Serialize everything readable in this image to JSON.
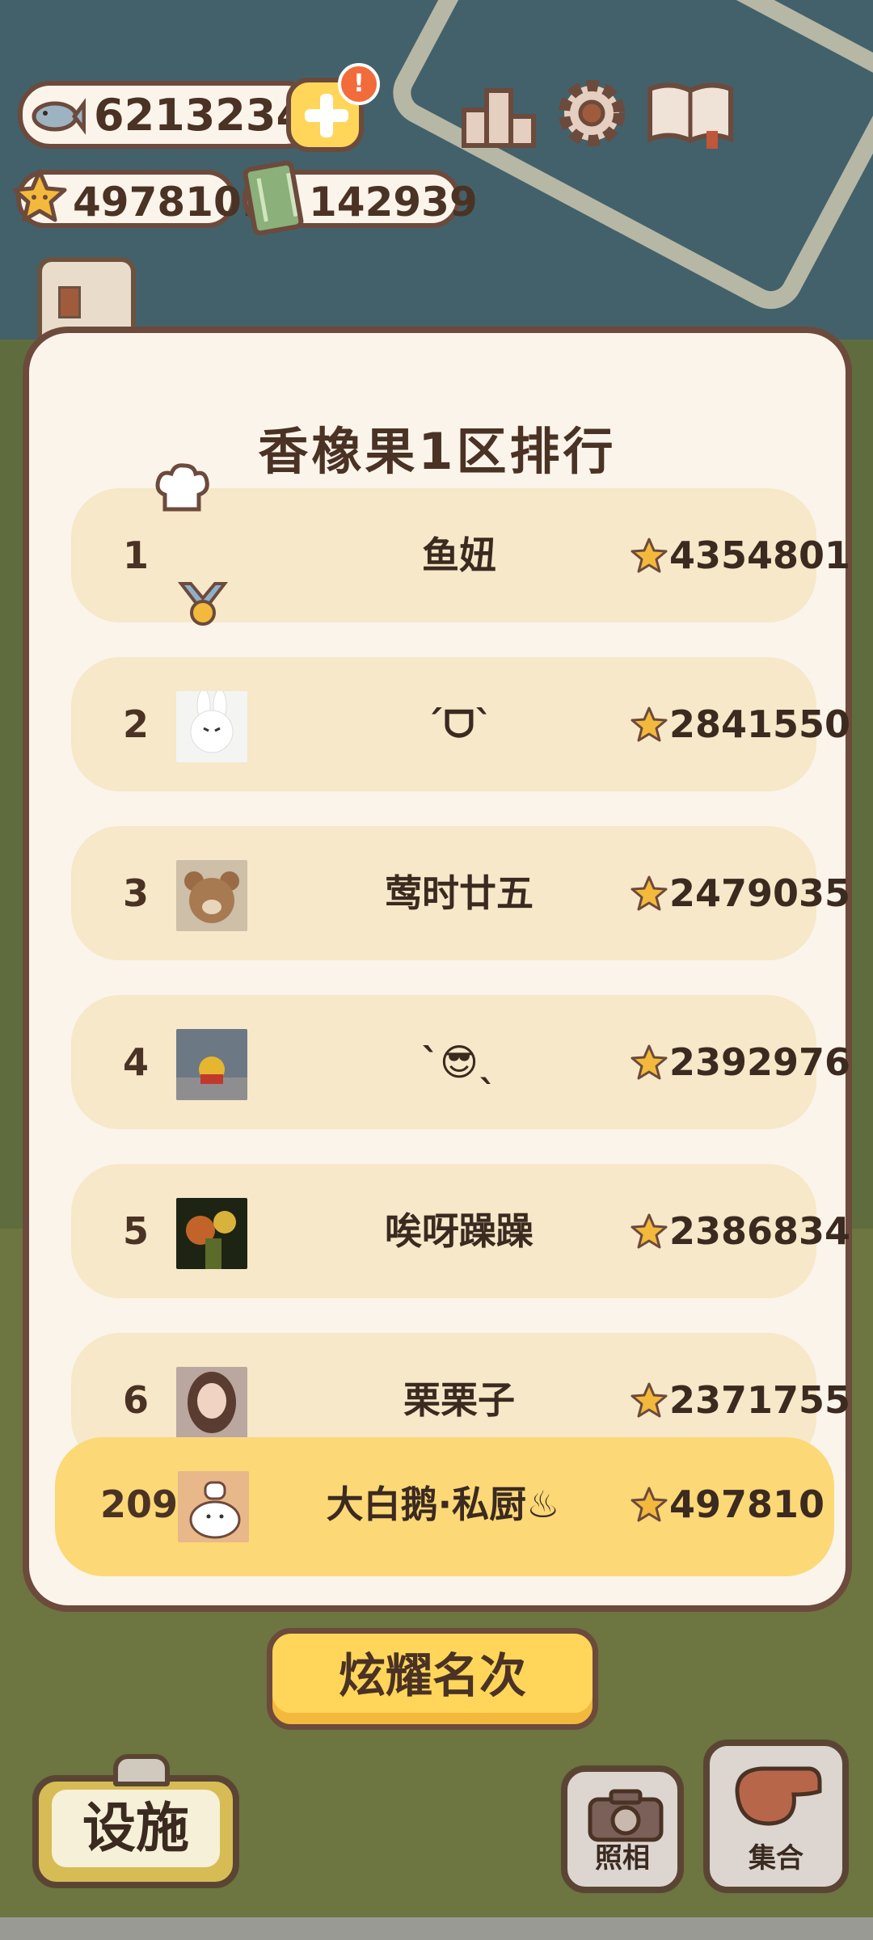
{
  "currencies": {
    "fish": "62132340",
    "stars": "497810.",
    "tickets": "142939",
    "alert_badge": "!"
  },
  "icons": {
    "fish": "fish-icon",
    "add": "plus-icon",
    "star": "star-icon",
    "ticket": "ticket-icon",
    "ranking": "podium-icon",
    "settings": "gear-icon",
    "guide": "book-icon"
  },
  "leaderboard": {
    "title": "香橡果1区排行",
    "rows": [
      {
        "rank": "1",
        "name": "鱼妞",
        "score": "4354801",
        "avatar": "none"
      },
      {
        "rank": "2",
        "name": "ˊᗜˋ",
        "score": "2841550",
        "avatar": "rabbit"
      },
      {
        "rank": "3",
        "name": "莺时廿五",
        "score": "2479035",
        "avatar": "bear"
      },
      {
        "rank": "4",
        "name": "ˋ😎ˎ",
        "score": "2392976",
        "avatar": "pooh"
      },
      {
        "rank": "5",
        "name": "唉呀躁躁",
        "score": "2386834",
        "avatar": "dark"
      },
      {
        "rank": "6",
        "name": "栗栗子",
        "score": "2371755",
        "avatar": "girl"
      }
    ],
    "me": {
      "rank": "209",
      "name": "大白鹅·私厨♨",
      "score": "497810",
      "avatar": "chef-cat"
    }
  },
  "buttons": {
    "share": "炫耀名次",
    "facility": "设施",
    "photo": "照相",
    "gather": "集合"
  },
  "colors": {
    "panel": "#fbf4ea",
    "row": "#f6e8c8",
    "highlight_row": "#fcd877",
    "accent": "#ffd65a",
    "outline": "#6c4a3c"
  }
}
